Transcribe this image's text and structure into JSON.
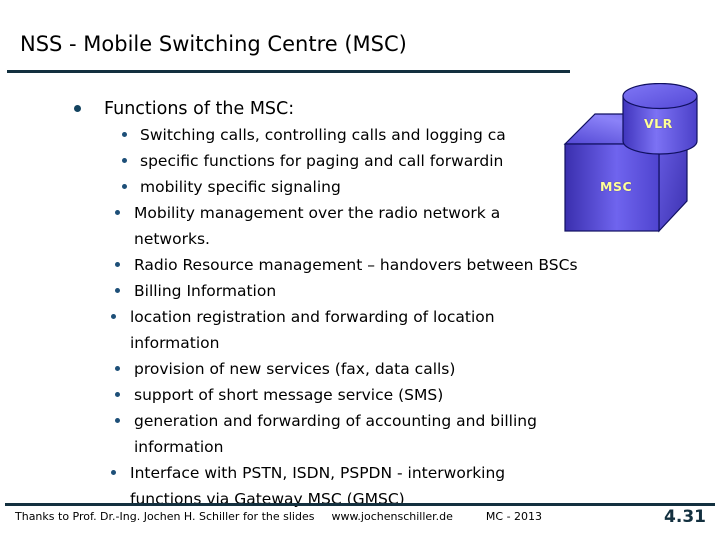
{
  "slide": {
    "title": "NSS - Mobile Switching Centre (MSC)",
    "bullets": [
      {
        "level": 1,
        "text": "Functions of the MSC:"
      },
      {
        "level": 2,
        "text": "Switching calls, controlling calls and logging calls"
      },
      {
        "level": 2,
        "text": " specific functions for paging and call forwarding"
      },
      {
        "level": 2,
        "text": " mobility specific signaling"
      },
      {
        "level": 2,
        "text": "Mobility management over the radio network and other networks."
      },
      {
        "level": 2,
        "text": "Radio Resource management – handovers between BSCs"
      },
      {
        "level": 2,
        "text": "Billing Information"
      },
      {
        "level": 2,
        "text": "location registration and forwarding of location information"
      },
      {
        "level": 2,
        "text": "provision of new services (fax, data calls)"
      },
      {
        "level": 2,
        "text": "support of short message service (SMS)"
      },
      {
        "level": 2,
        "text": "generation and forwarding of accounting and billing information"
      },
      {
        "level": 2,
        "text": "Interface with PSTN, ISDN, PSPDN - interworking functions via Gateway MSC (GMSC)"
      }
    ],
    "lines": {
      "l1": "Functions of the MSC:",
      "l2": "Switching calls, controlling calls and logging ca",
      "l3": " specific functions for paging and call forwardin",
      "l4": " mobility specific signaling",
      "l5a": "Mobility management over the radio network a",
      "l5b": "networks.",
      "l6": "Radio Resource management – handovers between BSCs",
      "l7": "Billing Information",
      "l8a": "location registration and forwarding of location",
      "l8b": "information",
      "l9": "provision of new services (fax, data calls)",
      "l10": "support of short message service (SMS)",
      "l11a": "generation and forwarding of accounting and billing",
      "l11b": "information",
      "l12a": "Interface with PSTN, ISDN, PSPDN - interworking",
      "l12b": "functions via Gateway MSC (GMSC)"
    }
  },
  "graphic": {
    "vlr_label": "VLR",
    "msc_label": "MSC",
    "label_color": "#ffff99",
    "fill_light": "#8a80f5",
    "fill_mid": "#5b4fd0",
    "fill_dark": "#4a3fc0",
    "outline": "#101060"
  },
  "footer": {
    "credit": "Thanks to Prof. Dr.-Ing. Jochen H. Schiller for the slides",
    "website": "www.jochenschiller.de",
    "course": "MC - 2013",
    "page_number": "4.31"
  },
  "theme": {
    "rule_color": "#13303f",
    "bullet_color": "#13435f",
    "sub_bullet_color": "#1d4f78",
    "title_color": "#000000",
    "body_color": "#000000"
  }
}
